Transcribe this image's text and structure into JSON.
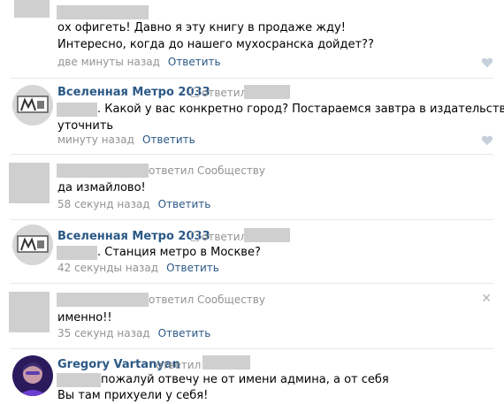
{
  "comments": [
    {
      "text_lines": [
        "ох офигеть! Давно я эту книгу в продаже жду!",
        "Интересно, когда до нашего мухосранска дойдет??"
      ],
      "time": "две минуты назад",
      "reply_label": "Ответить"
    },
    {
      "author": "Вселенная Метро 2033",
      "replied": "ответил",
      "text_lines": [
        ". Какой у вас конкретно город? Постараемся завтра в издательстве",
        "уточнить"
      ],
      "time": "минуту назад",
      "reply_label": "Ответить"
    },
    {
      "replied": "ответил Сообществу",
      "text_lines": [
        "да измайлово!"
      ],
      "time": "58 секунд назад",
      "reply_label": "Ответить"
    },
    {
      "author": "Вселенная Метро 2033",
      "replied": "ответил",
      "text_lines": [
        ". Станция метро в Москве?"
      ],
      "time": "42 секунды назад",
      "reply_label": "Ответить"
    },
    {
      "replied": "ответил Сообществу",
      "text_lines": [
        "именно!!"
      ],
      "time": "35 секунд назад",
      "reply_label": "Ответить"
    },
    {
      "author": "Gregory Vartanyan",
      "replied": "ответил",
      "text_lines": [
        "пожалуй отвечу не от имени админа, а от себя",
        "Вы там прихуели у себя!"
      ]
    }
  ],
  "colors": {
    "link": "#2a5885",
    "meta": "#939393",
    "separator": "#e7e8ec",
    "redacted": "#cfcfcf"
  },
  "icons": {
    "like": "heart-icon",
    "delete": "close-icon",
    "privacy": "lock-icon"
  }
}
